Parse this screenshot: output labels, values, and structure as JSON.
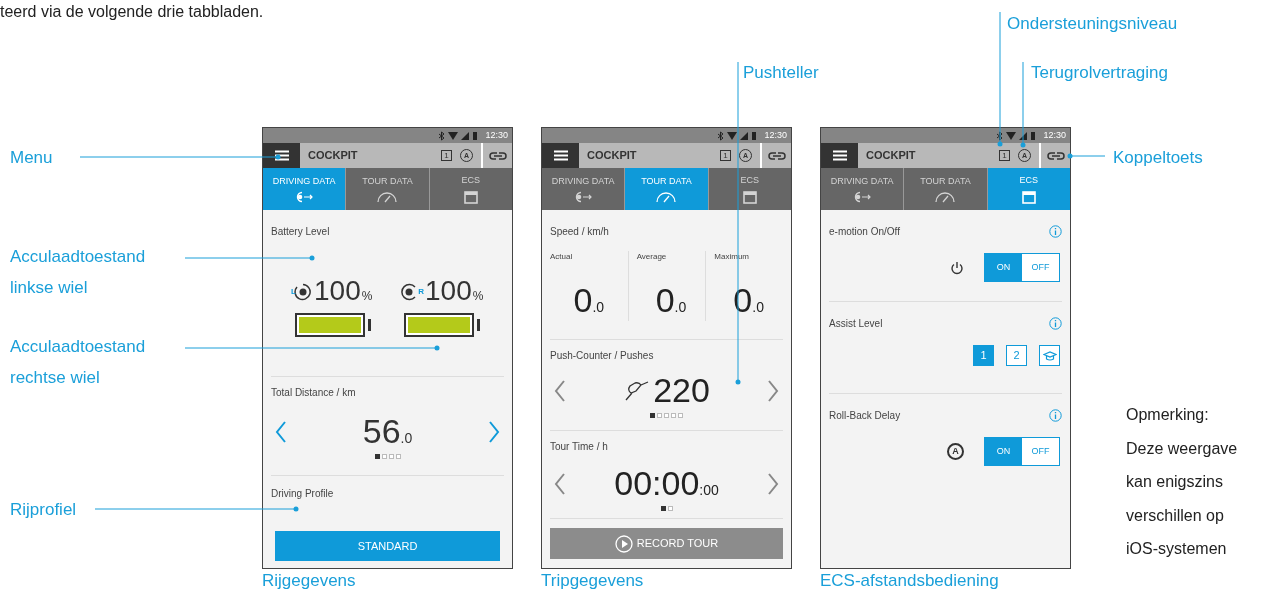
{
  "intro_text": "teerd via de volgende drie tabbladen.",
  "screens": [
    {
      "kind": "driving",
      "status_time": "12:30",
      "header_title": "COCKPIT",
      "header_indicators": [
        "1",
        "A"
      ],
      "tabs": [
        {
          "label": "DRIVING DATA",
          "selected": true
        },
        {
          "label": "TOUR DATA",
          "selected": false
        },
        {
          "label": "ECS",
          "selected": false
        }
      ],
      "battery": {
        "title": "Battery Level",
        "wheels": [
          {
            "side": "L",
            "value": "100",
            "unit": "%",
            "level": 1
          },
          {
            "side": "R",
            "value": "100",
            "unit": "%",
            "level": 1
          }
        ]
      },
      "distance": {
        "title": "Total Distance / km",
        "value": "56",
        "decimal": ".0",
        "pager": [
          {
            "selected": true
          },
          {
            "selected": false
          },
          {
            "selected": false
          },
          {
            "selected": false
          }
        ]
      },
      "profile": {
        "title": "Driving Profile",
        "button": "STANDARD"
      },
      "caption": "Rijgegevens"
    },
    {
      "kind": "tour",
      "status_time": "12:30",
      "header_title": "COCKPIT",
      "header_indicators": [
        "1",
        "A"
      ],
      "tabs": [
        {
          "label": "DRIVING DATA",
          "selected": false
        },
        {
          "label": "TOUR DATA",
          "selected": true
        },
        {
          "label": "ECS",
          "selected": false
        }
      ],
      "speed": {
        "title": "Speed / km/h",
        "columns": [
          {
            "label": "Actual",
            "value": "0",
            "decimal": ".0"
          },
          {
            "label": "Average",
            "value": "0",
            "decimal": ".0"
          },
          {
            "label": "Maximum",
            "value": "0",
            "decimal": ".0"
          }
        ]
      },
      "pushes": {
        "title": "Push-Counter / Pushes",
        "value": "220",
        "pager": [
          {
            "selected": true
          },
          {
            "selected": false
          },
          {
            "selected": false
          },
          {
            "selected": false
          },
          {
            "selected": false
          }
        ]
      },
      "time": {
        "title": "Tour Time / h",
        "value": "00:00",
        "decimal": ":00",
        "pager": [
          {
            "selected": true
          },
          {
            "selected": false
          }
        ]
      },
      "button": "RECORD TOUR",
      "caption": "Tripgegevens"
    },
    {
      "kind": "ecs",
      "status_time": "12:30",
      "header_title": "COCKPIT",
      "header_indicators": [
        "1",
        "A"
      ],
      "tabs": [
        {
          "label": "DRIVING DATA",
          "selected": false
        },
        {
          "label": "TOUR DATA",
          "selected": false
        },
        {
          "label": "ECS",
          "selected": true
        }
      ],
      "settings": [
        {
          "kind": "toggle",
          "title": "e-motion On/Off",
          "on_label": "ON",
          "off_label": "OFF",
          "on": true
        },
        {
          "kind": "levels",
          "title": "Assist Level",
          "options": [
            {
              "kind": "text",
              "label": "1",
              "selected": true
            },
            {
              "kind": "text",
              "label": "2",
              "selected": false
            },
            {
              "kind": "icon",
              "selected": false
            }
          ]
        },
        {
          "kind": "toggle",
          "title": "Roll-Back Delay",
          "symbol": "A",
          "on_label": "ON",
          "off_label": "OFF",
          "on": true
        }
      ],
      "caption": "ECS-afstandsbediening"
    }
  ],
  "annotations": [
    {
      "label": "Ondersteuningsniveau"
    },
    {
      "label": "Pushteller"
    },
    {
      "label": "Terugrolvertraging"
    },
    {
      "label": "Menu"
    },
    {
      "label": "Koppeltoets"
    },
    {
      "label": "Acculaadtoestand linkse wiel"
    },
    {
      "label": "Acculaadtoestand rechtse wiel"
    },
    {
      "label": "Rijprofiel"
    }
  ],
  "note_lines": [
    "Opmerking:",
    "Deze weergave",
    "kan enigszins",
    "verschillen op",
    "iOS-systemen"
  ]
}
